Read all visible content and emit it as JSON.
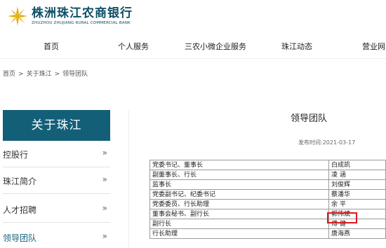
{
  "header": {
    "logo_cn": "株洲珠江农商银行",
    "logo_en": "ZHUZHOU ZHUJIANG RURAL COMMERCIAL BANK",
    "brand_color": "#0f4f66",
    "logo_mark_color": "#e5b21a"
  },
  "nav": {
    "items": [
      {
        "label": "首页"
      },
      {
        "label": "个人服务"
      },
      {
        "label": "三农小微企业服务"
      },
      {
        "label": "珠江动态"
      },
      {
        "label": "营业网"
      }
    ]
  },
  "breadcrumb": {
    "items": [
      "首页",
      "关于珠江",
      "领导团队"
    ],
    "separator": ">"
  },
  "sidebar": {
    "title": "关于珠江",
    "title_bg": "#135f78",
    "arrow": "»",
    "items": [
      {
        "label": "控股行"
      },
      {
        "label": "珠江简介"
      },
      {
        "label": "人才招聘"
      },
      {
        "label": "领导团队"
      }
    ]
  },
  "content": {
    "title": "领导团队",
    "date_label": "发布时间:2021-03-17"
  },
  "leaders": {
    "rows": [
      {
        "post": "党委书记、董事长",
        "name": "白成凯"
      },
      {
        "post": "副董事长、行长",
        "name": "凌  涵"
      },
      {
        "post": "监事长",
        "name": "刘俊辉"
      },
      {
        "post": "党委副书记、纪委书记",
        "name": "蔡潘华"
      },
      {
        "post": "党委委员、行长助理",
        "name": "余  平"
      },
      {
        "post": "董事会秘书、副行长",
        "name": "郭伟斌"
      },
      {
        "post": "副行长",
        "name": "傅  健"
      },
      {
        "post": "行长助理",
        "name": "唐海燕"
      }
    ],
    "highlight_color": "#e0161c"
  }
}
